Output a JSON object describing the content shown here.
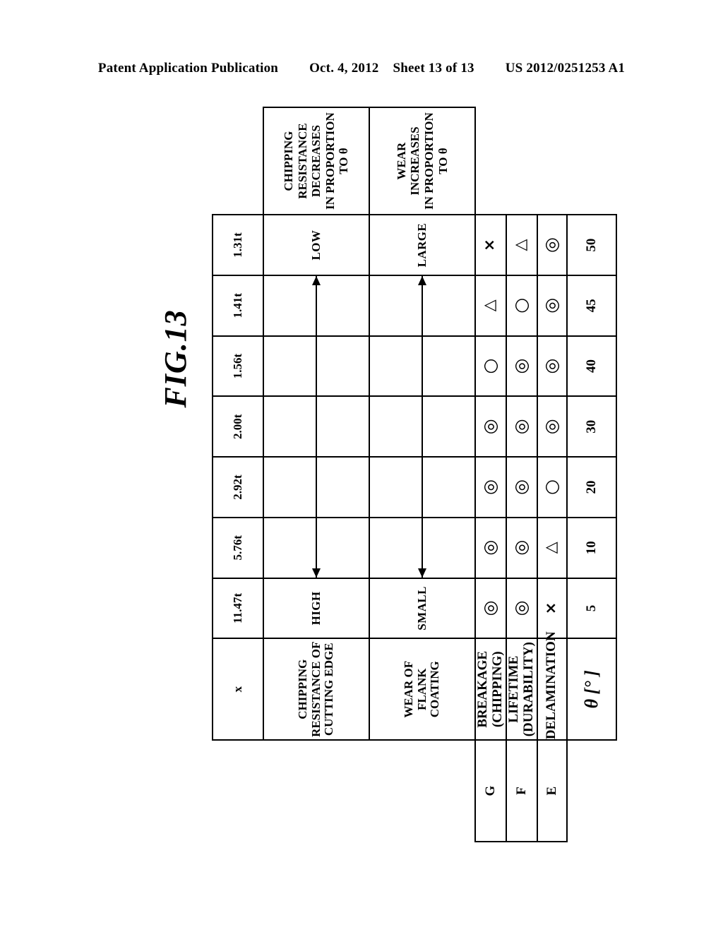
{
  "header": {
    "publication": "Patent Application Publication",
    "date": "Oct. 4, 2012",
    "sheet": "Sheet 13 of 13",
    "number": "US 2012/0251253 A1"
  },
  "figure": {
    "label": "FIG.13"
  },
  "table": {
    "theta_header": "θ [° ]",
    "theta_values": [
      "5",
      "10",
      "20",
      "30",
      "40",
      "45",
      "50"
    ],
    "letter_labels": {
      "delamination": "E",
      "lifetime": "F",
      "breakage": "G"
    },
    "column_headers": {
      "delamination": "DELAMINATION",
      "lifetime_line1": "LIFETIME",
      "lifetime_line2": "(DURABILITY)",
      "breakage_line1": "BREAKAGE",
      "breakage_line2": "(CHIPPING)",
      "wear_flank": "WEAR OF FLANK COATING",
      "chipping_resistance_line1": "CHIPPING RESISTANCE OF",
      "chipping_resistance_line2": "CUTTING EDGE",
      "x_label": "x"
    },
    "rows": {
      "delamination": [
        "×",
        "△",
        "○",
        "◎",
        "◎",
        "◎",
        "◎"
      ],
      "lifetime": [
        "◎",
        "◎",
        "◎",
        "◎",
        "◎",
        "○",
        "△"
      ],
      "breakage": [
        "◎",
        "◎",
        "◎",
        "◎",
        "○",
        "△",
        "×"
      ],
      "x_values": [
        "11.47t",
        "5.76t",
        "2.92t",
        "2.00t",
        "1.56t",
        "1.41t",
        "1.31t"
      ]
    },
    "bands": {
      "wear": {
        "start_label": "SMALL",
        "end_label": "LARGE",
        "note_line1": "WEAR INCREASES",
        "note_line2": "IN PROPORTION TO θ"
      },
      "chipping": {
        "start_label": "HIGH",
        "end_label": "LOW",
        "note_line1": "CHIPPING RESISTANCE DECREASES",
        "note_line2": "IN PROPORTION TO θ"
      }
    }
  },
  "colors": {
    "ink": "#000000",
    "paper": "#ffffff"
  }
}
